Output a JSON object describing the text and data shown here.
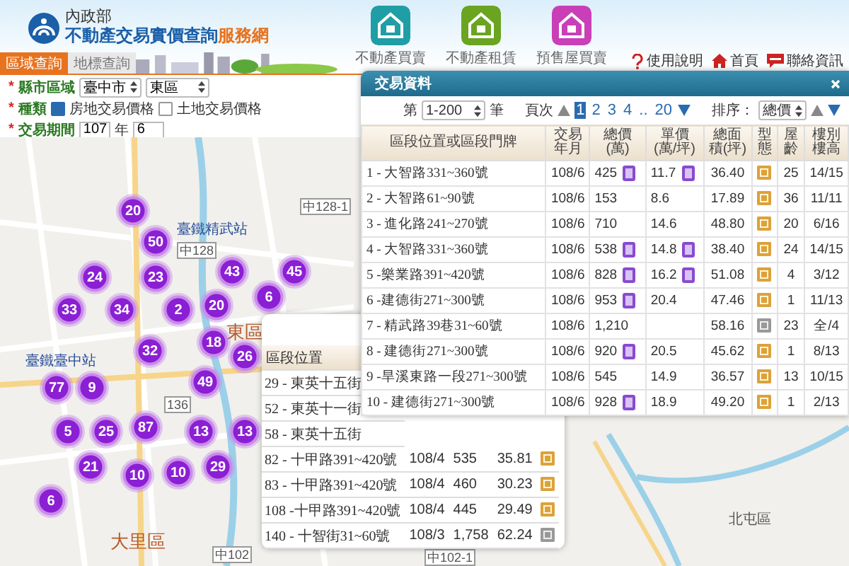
{
  "header": {
    "ministry": "內政部",
    "title": "不動產交易實價查詢",
    "title_suffix": "服務網",
    "apps": [
      {
        "label": "不動產買賣",
        "color": "#1f9ea6"
      },
      {
        "label": "不動產租賃",
        "color": "#6aa421"
      },
      {
        "label": "預售屋買賣",
        "color": "#c93fb8"
      }
    ],
    "links": [
      {
        "label": "使用說明",
        "kind": "help"
      },
      {
        "label": "首頁",
        "kind": "home"
      },
      {
        "label": "聯絡資訊",
        "kind": "contact"
      }
    ]
  },
  "tabs": [
    {
      "label": "區域查詢",
      "selected": true
    },
    {
      "label": "地標查詢",
      "selected": false
    }
  ],
  "filters": {
    "region": {
      "mark": "*",
      "label": "縣市區域",
      "city": "臺中市",
      "district": "東區"
    },
    "kind": {
      "mark": "*",
      "label": "種類",
      "options": [
        {
          "label": "房地交易價格",
          "checked": true
        },
        {
          "label": "土地交易價格",
          "checked": false
        }
      ]
    },
    "period": {
      "mark": "*",
      "label": "交易期間",
      "year": "107",
      "year_unit": "年",
      "month": "6"
    }
  },
  "map": {
    "clusters": [
      {
        "count": "20"
      },
      {
        "count": "50"
      },
      {
        "count": "24"
      },
      {
        "count": "23"
      },
      {
        "count": "43"
      },
      {
        "count": "45"
      },
      {
        "count": "33"
      },
      {
        "count": "34"
      },
      {
        "count": "2"
      },
      {
        "count": "20"
      },
      {
        "count": "6"
      },
      {
        "count": "32"
      },
      {
        "count": "18"
      },
      {
        "count": "26"
      },
      {
        "count": "77"
      },
      {
        "count": "9"
      },
      {
        "count": "49"
      },
      {
        "count": "5"
      },
      {
        "count": "25"
      },
      {
        "count": "87"
      },
      {
        "count": "13"
      },
      {
        "count": "13"
      },
      {
        "count": "21"
      },
      {
        "count": "10"
      },
      {
        "count": "10"
      },
      {
        "count": "29"
      },
      {
        "count": "6"
      }
    ],
    "labels": [
      {
        "text": "東區",
        "kind": "district"
      },
      {
        "text": "大里區",
        "kind": "district"
      },
      {
        "text": "北屯區",
        "kind": "area"
      },
      {
        "text": "臺鐵精武站",
        "kind": "station"
      },
      {
        "text": "臺鐵臺中站",
        "kind": "station"
      },
      {
        "text": "中128",
        "kind": "road"
      },
      {
        "text": "中128-1",
        "kind": "road"
      },
      {
        "text": "136",
        "kind": "road"
      },
      {
        "text": "中102",
        "kind": "road"
      },
      {
        "text": "中102-1",
        "kind": "road"
      }
    ]
  },
  "back_panel": {
    "header": "區段位置",
    "rows": [
      {
        "address": "29 - 東英十五街"
      },
      {
        "address": "52 - 東英十一街"
      },
      {
        "address": "58 - 東英十五街"
      },
      {
        "address": "82 - 十甲路391~420號",
        "date": "108/4",
        "total": "535",
        "area": "35.81",
        "kind": "residential"
      },
      {
        "address": "83 - 十甲路391~420號",
        "date": "108/4",
        "total": "460",
        "area": "30.23",
        "kind": "residential"
      },
      {
        "address": "108 -十甲路391~420號",
        "date": "108/4",
        "total": "445",
        "area": "29.49",
        "kind": "residential"
      },
      {
        "address": "140 - 十智街31~60號",
        "date": "108/3",
        "total": "1,758",
        "area": "62.24",
        "kind": "other"
      }
    ]
  },
  "transactions": {
    "title": "交易資料",
    "range_prefix": "第",
    "range": "1-200",
    "range_suffix": "筆",
    "page_label": "頁次",
    "pages": [
      {
        "label": "1",
        "selected": true
      },
      {
        "label": "2",
        "selected": false
      },
      {
        "label": "3",
        "selected": false
      },
      {
        "label": "4",
        "selected": false
      },
      {
        "label": "..",
        "selected": false
      },
      {
        "label": "20",
        "selected": false
      }
    ],
    "sort_label": "排序：",
    "sort": "總價",
    "columns": [
      "區段位置或區段門牌",
      "交易年月",
      "總價(萬)",
      "單價(萬/坪)",
      "總面積(坪)",
      "型態",
      "屋齡",
      "樓別樓高"
    ],
    "rows": [
      {
        "address": "1 - 大智路331~360號",
        "date": "108/6",
        "total": "425",
        "price_detail": true,
        "unit": "11.7",
        "unit_detail": true,
        "area": "36.40",
        "kind": "residential",
        "age": "25",
        "floor": "14/15"
      },
      {
        "address": "2 - 大智路61~90號",
        "date": "108/6",
        "total": "153",
        "price_detail": false,
        "unit": "8.6",
        "unit_detail": false,
        "area": "17.89",
        "kind": "residential",
        "age": "36",
        "floor": "11/11"
      },
      {
        "address": "3 - 進化路241~270號",
        "date": "108/6",
        "total": "710",
        "price_detail": false,
        "unit": "14.6",
        "unit_detail": false,
        "area": "48.80",
        "kind": "residential",
        "age": "20",
        "floor": "6/16"
      },
      {
        "address": "4 - 大智路331~360號",
        "date": "108/6",
        "total": "538",
        "price_detail": true,
        "unit": "14.8",
        "unit_detail": true,
        "area": "38.40",
        "kind": "residential",
        "age": "24",
        "floor": "14/15"
      },
      {
        "address": "5 -樂業路391~420號",
        "date": "108/6",
        "total": "828",
        "price_detail": true,
        "unit": "16.2",
        "unit_detail": true,
        "area": "51.08",
        "kind": "residential",
        "age": "4",
        "floor": "3/12"
      },
      {
        "address": "6 -建德街271~300號",
        "date": "108/6",
        "total": "953",
        "price_detail": true,
        "unit": "20.4",
        "unit_detail": false,
        "area": "47.46",
        "kind": "residential",
        "age": "1",
        "floor": "11/13"
      },
      {
        "address": "7 - 精武路39巷31~60號",
        "date": "108/6",
        "total": "1,210",
        "price_detail": false,
        "unit_detail": false,
        "area": "58.16",
        "kind": "other",
        "age": "23",
        "floor": "全/4"
      },
      {
        "address": "8 - 建德街271~300號",
        "date": "108/6",
        "total": "920",
        "price_detail": true,
        "unit": "20.5",
        "unit_detail": false,
        "area": "45.62",
        "kind": "residential",
        "age": "1",
        "floor": "8/13"
      },
      {
        "address": "9 -旱溪東路一段271~300號",
        "date": "108/6",
        "total": "545",
        "price_detail": false,
        "unit": "14.9",
        "unit_detail": false,
        "area": "36.57",
        "kind": "residential",
        "age": "13",
        "floor": "10/15"
      },
      {
        "address": "10 - 建德街271~300號",
        "date": "108/6",
        "total": "928",
        "price_detail": true,
        "unit": "18.9",
        "unit_detail": false,
        "area": "49.20",
        "kind": "residential",
        "age": "1",
        "floor": "2/13"
      }
    ]
  }
}
